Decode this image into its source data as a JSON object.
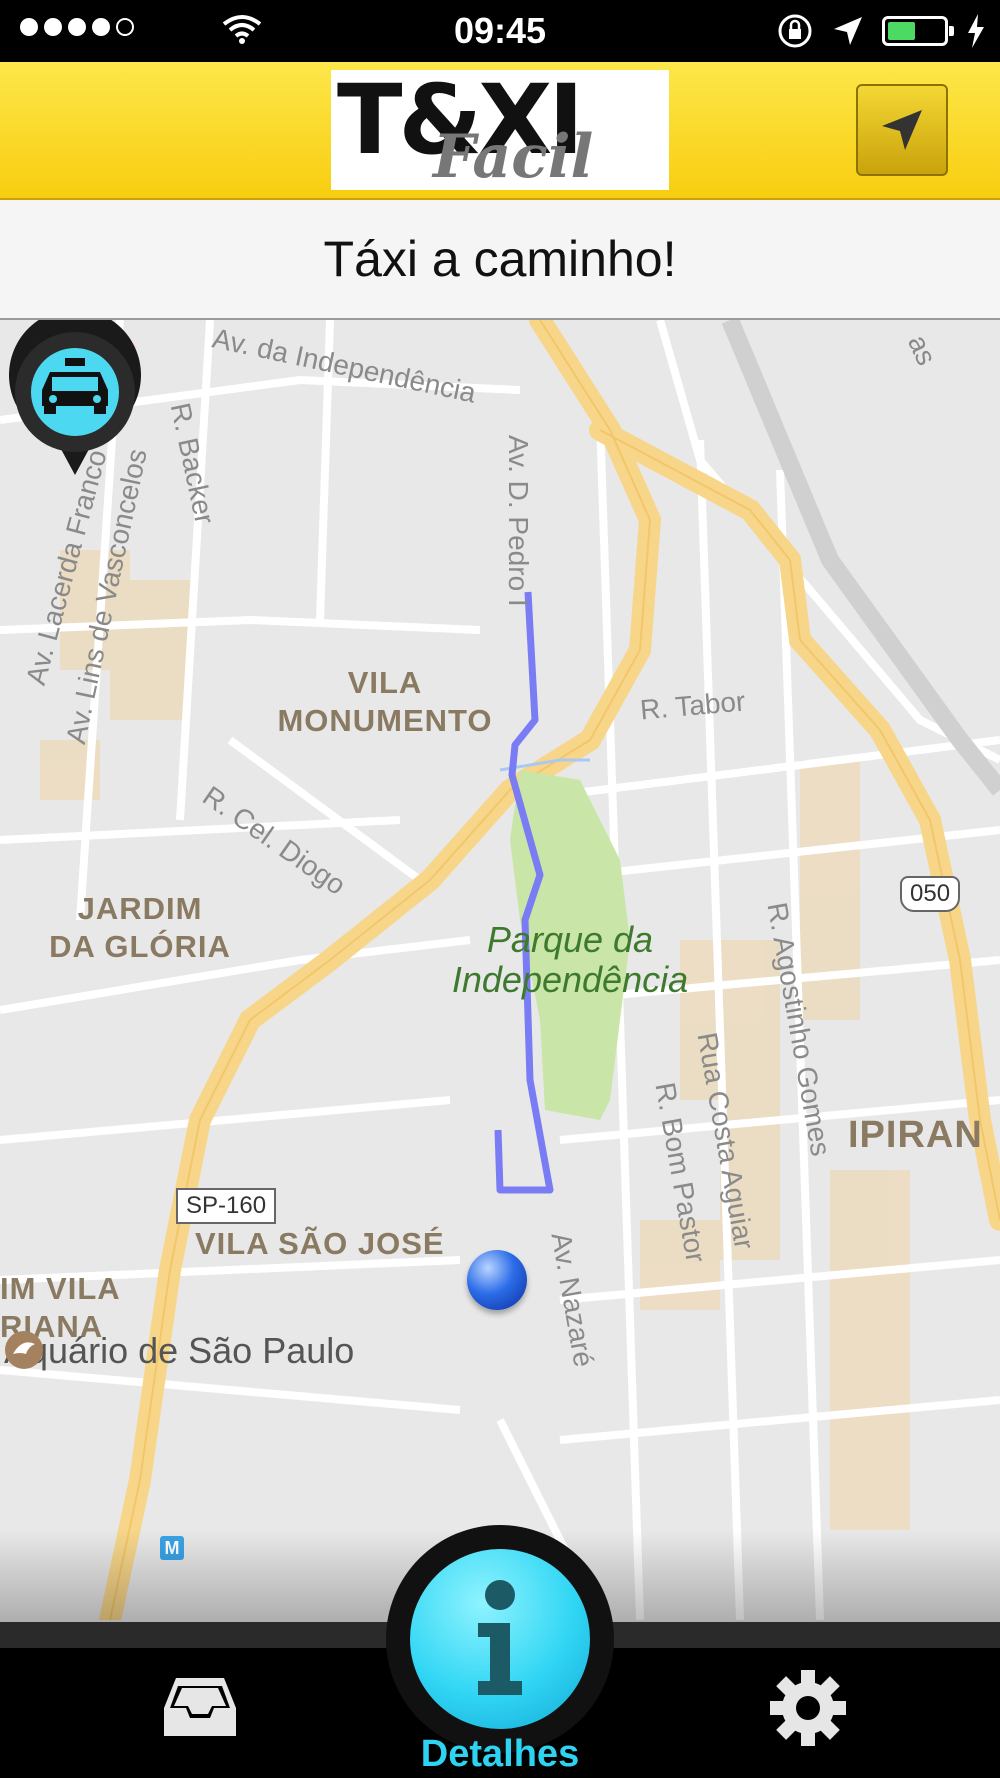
{
  "status_bar": {
    "time": "09:45",
    "signal_bars": 4,
    "battery_level": 0.45
  },
  "header": {
    "logo_main": "T&XI",
    "logo_sub": "Facil"
  },
  "banner": {
    "message": "Táxi a caminho!"
  },
  "map": {
    "areas": [
      "VILA",
      "MONUMENTO",
      "JARDIM",
      "DA GLÓRIA",
      "VILA SÃO JOSÉ",
      "IPIRAN",
      "IM VILA",
      "RIANA"
    ],
    "streets": [
      "Av. da Independência",
      "R. Backer",
      "Av. Lacerda Franco",
      "Av. Lins de Vasconcelos",
      "R. Cel. Diogo",
      "R. Tabor",
      "R. Agostinho Gomes",
      "Rua Costa Aguiar",
      "R. Bom Pastor",
      "Av. Nazaré",
      "Av. D. Pedro I",
      "as"
    ],
    "park": [
      "Parque da",
      "Independência"
    ],
    "poi": "Aquário de São Paulo",
    "road_shields": [
      "SP-160",
      "050"
    ],
    "metro": "M"
  },
  "tabbar": {
    "details_label": "Detalhes"
  },
  "colors": {
    "header_yellow": "#f8cd10",
    "route_blue": "#7a7cf4",
    "details_cyan": "#31d6f4",
    "highway_orange": "#f7d68a"
  }
}
